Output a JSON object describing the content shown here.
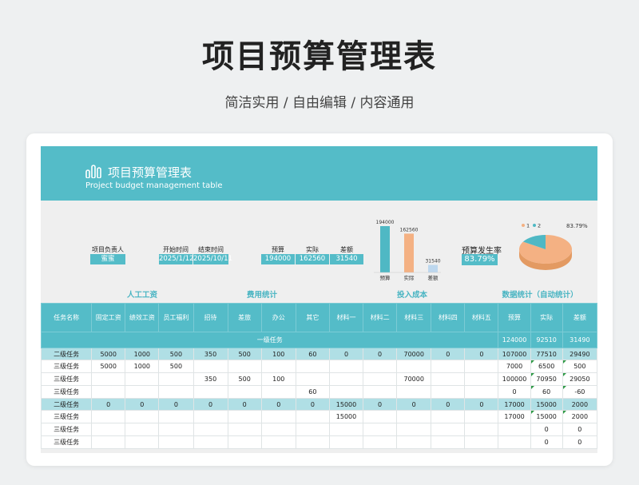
{
  "page": {
    "title": "项目预算管理表",
    "subtitle": "简洁实用 / 自由编辑 / 内容通用"
  },
  "banner": {
    "title": "项目预算管理表",
    "subtitle_en": "Project budget management table",
    "icon": "bar-chart-icon"
  },
  "summary": {
    "owner_label": "项目负责人",
    "owner_value": "蜜蜜",
    "start_label": "开始时间",
    "start_value": "2025/1/12",
    "end_label": "结束时间",
    "end_value": "2025/10/11",
    "budget_label": "预算",
    "budget_value": "194000",
    "actual_label": "实际",
    "actual_value": "162560",
    "diff_label": "差额",
    "diff_value": "31540",
    "rate_label": "预算发生率",
    "rate_value": "83.79%"
  },
  "chart_data": [
    {
      "type": "bar",
      "categories": [
        "预算",
        "实际",
        "差额"
      ],
      "values": [
        194000,
        162560,
        31540
      ],
      "colors": [
        "#4fb8c4",
        "#f4b183",
        "#bdd7ee"
      ],
      "data_labels": [
        "194000",
        "162560",
        "31540"
      ]
    },
    {
      "type": "pie",
      "labels": [
        "1",
        "2"
      ],
      "values": [
        83.79,
        16.21
      ],
      "colors": [
        "#f4b183",
        "#4fb8c4"
      ],
      "data_label": "83.79%"
    }
  ],
  "sections": {
    "labor": "人工工资",
    "expense": "费用统计",
    "input": "投入成本",
    "stats": "数据统计（自动统计）"
  },
  "table": {
    "headers": [
      "任务名称",
      "固定工资",
      "绩效工资",
      "员工福利",
      "招待",
      "差旅",
      "办公",
      "其它",
      "材料一",
      "材料二",
      "材料三",
      "材料四",
      "材料五",
      "预算",
      "实际",
      "差额"
    ],
    "level1": {
      "label": "一级任务",
      "budget": "124000",
      "actual": "92510",
      "diff": "31490"
    },
    "rows": [
      {
        "level": 2,
        "cells": [
          "二级任务",
          "5000",
          "1000",
          "500",
          "350",
          "500",
          "100",
          "60",
          "0",
          "0",
          "70000",
          "0",
          "0",
          "107000",
          "77510",
          "29490"
        ]
      },
      {
        "level": 3,
        "cells": [
          "三级任务",
          "5000",
          "1000",
          "500",
          "",
          "",
          "",
          "",
          "",
          "",
          "",
          "",
          "",
          "7000",
          "6500",
          "500"
        ]
      },
      {
        "level": 3,
        "cells": [
          "三级任务",
          "",
          "",
          "",
          "350",
          "500",
          "100",
          "",
          "",
          "",
          "70000",
          "",
          "",
          "100000",
          "70950",
          "29050"
        ]
      },
      {
        "level": 3,
        "cells": [
          "三级任务",
          "",
          "",
          "",
          "",
          "",
          "",
          "60",
          "",
          "",
          "",
          "",
          "",
          "0",
          "60",
          "-60"
        ]
      },
      {
        "level": 2,
        "cells": [
          "二级任务",
          "0",
          "0",
          "0",
          "0",
          "0",
          "0",
          "0",
          "15000",
          "0",
          "0",
          "0",
          "0",
          "17000",
          "15000",
          "2000"
        ]
      },
      {
        "level": 3,
        "cells": [
          "三级任务",
          "",
          "",
          "",
          "",
          "",
          "",
          "",
          "15000",
          "",
          "",
          "",
          "",
          "17000",
          "15000",
          "2000"
        ]
      },
      {
        "level": 3,
        "cells": [
          "三级任务",
          "",
          "",
          "",
          "",
          "",
          "",
          "",
          "",
          "",
          "",
          "",
          "",
          "",
          "0",
          "0"
        ]
      },
      {
        "level": 3,
        "cells": [
          "三级任务",
          "",
          "",
          "",
          "",
          "",
          "",
          "",
          "",
          "",
          "",
          "",
          "",
          "",
          "0",
          "0"
        ]
      }
    ]
  }
}
